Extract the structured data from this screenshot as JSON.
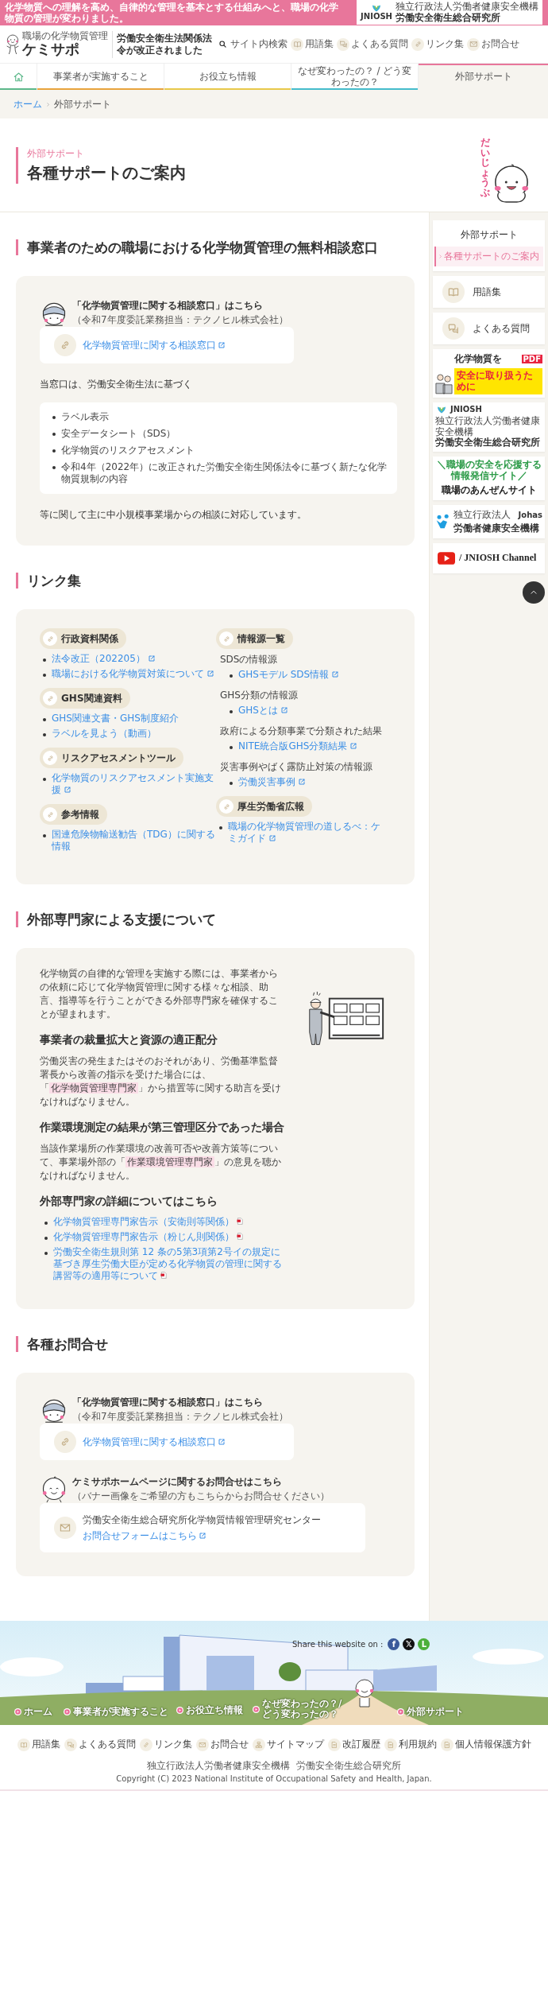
{
  "top_bar": {
    "message": "化学物質への理解を高め、自律的な管理を基本とする仕組みへと、職場の化学物質の管理が変わりました。",
    "org_logo": {
      "mark": "JNIOSH",
      "org": "独立行政法人労働者健康安全機構",
      "name": "労働安全衛生総合研究所"
    }
  },
  "header": {
    "logo": {
      "tagline": "職場の化学物質管理",
      "name": "ケミサポ"
    },
    "notice": "労働安全衛生法関係法令が改正されました",
    "utility_links": [
      {
        "kind": "search",
        "label": "サイト内検索"
      },
      {
        "kind": "book",
        "label": "用語集"
      },
      {
        "kind": "faq",
        "label": "よくある質問"
      },
      {
        "kind": "link",
        "label": "リンク集"
      },
      {
        "kind": "mail",
        "label": "お問合せ"
      }
    ]
  },
  "nav": [
    {
      "kind": "home",
      "selected": false,
      "color": "#5cb88a"
    },
    {
      "kind": "text",
      "label": "事業者が実施すること",
      "selected": false,
      "color": "#e8a33c"
    },
    {
      "kind": "text",
      "label": "お役立ち情報",
      "selected": false,
      "color": "#e8c94a"
    },
    {
      "kind": "text",
      "label": "なぜ変わったの？ / どう変わったの？",
      "selected": false,
      "color": "#45bccb"
    },
    {
      "kind": "text",
      "label": "外部サポート",
      "selected": true,
      "color": "#e8769b"
    }
  ],
  "breadcrumb": [
    {
      "label": "ホーム",
      "current": false
    },
    {
      "label": "外部サポート",
      "current": true
    }
  ],
  "page_header": {
    "eyebrow": "外部サポート",
    "title": "各種サポートのご案内",
    "mascot_text": "だいじょうぶ"
  },
  "sections": [
    {
      "kind": "consult",
      "heading": "事業者のための職場における化学物質管理の無料相談窓口",
      "contacts": [
        {
          "kind": "consult",
          "title": "「化学物質管理に関する相談窓口」はこちら",
          "note": "（令和7年度委託業務担当：テクノヒル株式会社）",
          "lines": [
            {
              "text": "化学物質管理に関する相談窓口",
              "link": true,
              "external": true
            }
          ]
        }
      ],
      "intro": "当窓口は、労働安全衛生法に基づく",
      "items": [
        "ラベル表示",
        "安全データシート（SDS）",
        "化学物質のリスクアセスメント",
        "令和4年（2022年）に改正された労働安全衛生関係法令に基づく新たな化学物質規制の内容"
      ],
      "outro": "等に関して主に中小規模事業場からの相談に対応しています。"
    },
    {
      "kind": "links",
      "heading": "リンク集",
      "columns": [
        [
          {
            "title": "行政資料関係",
            "items": [
              {
                "kind": "link",
                "text": "法令改正（202205）",
                "external": true
              },
              {
                "kind": "link",
                "text": "職場における化学物質対策について",
                "external": true
              }
            ]
          },
          {
            "title": "GHS関連資料",
            "items": [
              {
                "kind": "link",
                "text": "GHS関連文書・GHS制度紹介",
                "external": false
              },
              {
                "kind": "link",
                "text": "ラベルを見よう（動画）",
                "external": false
              }
            ]
          },
          {
            "title": "リスクアセスメントツール",
            "items": [
              {
                "kind": "link",
                "text": "化学物質のリスクアセスメント実施支援",
                "external": true
              }
            ]
          },
          {
            "title": "参考情報",
            "items": [
              {
                "kind": "link",
                "text": "国連危険物輸送勧告（TDG）に関する情報",
                "external": false
              }
            ]
          }
        ],
        [
          {
            "title": "情報源一覧",
            "items": [
              {
                "kind": "caption",
                "text": "SDSの情報源",
                "links": [
                  {
                    "text": "GHSモデル SDS情報",
                    "external": true
                  }
                ]
              },
              {
                "kind": "caption",
                "text": "GHS分類の情報源",
                "links": [
                  {
                    "text": "GHSとは",
                    "external": true
                  }
                ]
              },
              {
                "kind": "caption",
                "text": "政府による分類事業で分類された結果",
                "links": [
                  {
                    "text": "NITE統合版GHS分類結果",
                    "external": true
                  }
                ]
              },
              {
                "kind": "caption",
                "text": "災害事例やばく露防止対策の情報源",
                "links": [
                  {
                    "text": "労働災害事例",
                    "external": true
                  }
                ]
              }
            ]
          },
          {
            "title": "厚生労働省広報",
            "items": [
              {
                "kind": "link",
                "text": "職場の化学物質管理の道しるべ：ケミガイド",
                "external": true
              }
            ]
          }
        ]
      ]
    },
    {
      "kind": "experts",
      "heading": "外部専門家による支援について",
      "blocks": [
        {
          "kind": "p",
          "lines": [
            [
              {
                "text": "化学物質の自律的な管理を実施する際には、事業者からの依頼に応じて化学物質管理に関する様々な相談、助言、指導等を行うことができる外部専門家を確保することが望まれます。",
                "highlight": false
              }
            ]
          ]
        },
        {
          "kind": "h3",
          "text": "事業者の裁量拡大と資源の適正配分"
        },
        {
          "kind": "p",
          "lines": [
            [
              {
                "text": "労働災害の発生またはそのおそれがあり、労働基準監督署長から改善の指示を受けた場合には、",
                "highlight": false
              }
            ],
            [
              {
                "text": "「",
                "highlight": false
              },
              {
                "text": "化学物質管理専門家",
                "highlight": true
              },
              {
                "text": "」から措置等に関する助言を受けなければなりません。",
                "highlight": false
              }
            ]
          ]
        },
        {
          "kind": "h3",
          "text": "作業環境測定の結果が第三管理区分であった場合"
        },
        {
          "kind": "p",
          "lines": [
            [
              {
                "text": "当該作業場所の作業環境の改善可否や改善方策等について、事業場外部の「",
                "highlight": false
              },
              {
                "text": "作業環境管理専門家",
                "highlight": true
              },
              {
                "text": "」の意見を聴かなければなりません。",
                "highlight": false
              }
            ]
          ]
        },
        {
          "kind": "h3",
          "text": "外部専門家の詳細についてはこちら"
        },
        {
          "kind": "list",
          "links": [
            {
              "text": "化学物質管理専門家告示（安衛則等関係）",
              "kind": "pdf"
            },
            {
              "text": "化学物質管理専門家告示（粉じん則関係）",
              "kind": "pdf"
            },
            {
              "text": "労働安全衛生規則第 12 条の5第3項第2号イの規定に基づき厚生労働大臣が定める化学物質の管理に関する講習等の適用等について",
              "kind": "pdf"
            }
          ]
        }
      ]
    },
    {
      "kind": "contact",
      "heading": "各種お問合せ",
      "contacts": [
        {
          "kind": "consult",
          "title": "「化学物質管理に関する相談窓口」はこちら",
          "note": "（令和7年度委託業務担当：テクノヒル株式会社）",
          "lines": [
            {
              "text": "化学物質管理に関する相談窓口",
              "link": true,
              "external": true
            }
          ]
        },
        {
          "kind": "inquiry",
          "title": "ケミサポホームページに関するお問合せはこちら",
          "note": "（バナー画像をご希望の方もこちらからお問合せください）",
          "lines": [
            {
              "text": "労働安全衛生総合研究所化学物質情報管理研究センター",
              "link": false
            },
            {
              "text": "お問合せフォームはこちら",
              "link": true,
              "external": true
            }
          ]
        }
      ]
    }
  ],
  "sidebar": {
    "menu": {
      "title": "外部サポート",
      "items": [
        {
          "label": "各種サポートのご案内",
          "selected": true
        }
      ]
    },
    "quick_links": [
      {
        "kind": "book",
        "label": "用語集"
      },
      {
        "kind": "faq",
        "label": "よくある質問"
      }
    ],
    "banners": [
      {
        "kind": "handling",
        "title": "化学物質を",
        "highlight": "安全に取り扱うために",
        "badge": "PDF"
      },
      {
        "kind": "institute",
        "mark": "JNIOSH",
        "org": "独立行政法人労働者健康安全機構",
        "name": "労働安全衛生総合研究所"
      },
      {
        "kind": "anzen",
        "tagline": "＼職場の安全を応援する情報発信サイト／",
        "name": "職場のあんぜんサイト"
      },
      {
        "kind": "johas",
        "org": "独立行政法人",
        "mark": "Johas",
        "name": "労働者健康安全機構"
      },
      {
        "kind": "youtube",
        "name": "/ JNIOSH Channel"
      }
    ]
  },
  "footer": {
    "share_label": "Share this website on :",
    "share": [
      {
        "glyph": "f",
        "color": "#3b5a9a"
      },
      {
        "glyph": "𝕏",
        "color": "#111111"
      },
      {
        "glyph": "L",
        "color": "#4caf3a"
      }
    ],
    "nav": [
      "ホーム",
      "事業者が実施すること",
      "お役立ち情報",
      "なぜ変わったの？/ どう変わったの？",
      "外部サポート"
    ],
    "links": [
      {
        "kind": "book",
        "label": "用語集"
      },
      {
        "kind": "faq",
        "label": "よくある質問"
      },
      {
        "kind": "link",
        "label": "リンク集"
      },
      {
        "kind": "mail",
        "label": "お問合せ"
      },
      {
        "kind": "sitemap",
        "label": "サイトマップ"
      },
      {
        "kind": "doc",
        "label": "改訂履歴"
      },
      {
        "kind": "doc",
        "label": "利用規約"
      },
      {
        "kind": "doc",
        "label": "個人情報保護方針"
      }
    ],
    "copyright": [
      "独立行政法人労働者健康安全機構",
      "労働安全衛生総合研究所",
      "Copyright (C) 2023 National Institute of Occupational Safety and Health, Japan."
    ]
  }
}
